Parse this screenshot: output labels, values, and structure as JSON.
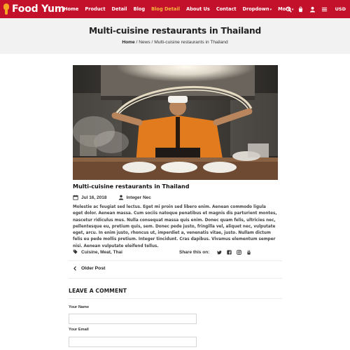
{
  "header": {
    "logo_text": "Food Yum",
    "nav": [
      {
        "label": "Home",
        "active": false,
        "caret": ""
      },
      {
        "label": "Product",
        "active": false,
        "caret": ""
      },
      {
        "label": "Detail",
        "active": false,
        "caret": ""
      },
      {
        "label": "Blog",
        "active": false,
        "caret": ""
      },
      {
        "label": "Blog Detail",
        "active": true,
        "caret": ""
      },
      {
        "label": "About Us",
        "active": false,
        "caret": ""
      },
      {
        "label": "Contact",
        "active": false,
        "caret": ""
      },
      {
        "label": "Dropdown",
        "active": false,
        "caret": "▾"
      },
      {
        "label": "More",
        "active": false,
        "caret": "▾"
      }
    ],
    "icons": [
      "search-icon",
      "cart-icon",
      "user-icon",
      "menu-icon"
    ],
    "currency": "USD",
    "colors": {
      "bar": "#c4112b",
      "active": "#f6b93b",
      "logo_accent": "#f5a623"
    }
  },
  "page": {
    "title": "Multi-cuisine restaurants in Thailand",
    "breadcrumb": {
      "home": "Home",
      "sep1": " / ",
      "news": "News",
      "sep2": " / ",
      "current": "Multi-cuisine restaurants in Thailand"
    }
  },
  "post": {
    "title": "Multi-cuisine restaurants in Thailand",
    "date": "Jul 16, 2018",
    "author": "Integer Nec",
    "body": "Molestie ac feugiat sed lectus. Eget mi proin sed libero enim. Aenean commodo ligula eget dolor. Aenean massa. Cum sociis natoque penatibus et magnis dis parturient montes, nascetur ridiculus mus. Nulla consequat massa quis enim. Donec quam felis, ultricies nec, pellentesque eu, pretium quis, sem. Donec pede justo, fringilla vel, aliquet nec, vulputate eget, arcu. In enim justo, rhoncus ut, imperdiet a, venenatis vitae, justo. Nullam dictum felis eu pede mollis pretium. Integer tincidunt. Cras dapibus. Vivamus elementum semper nisi. Aenean vulputate eleifend tellus.",
    "tags": [
      "Cuisine",
      "Meat",
      "Thai"
    ],
    "share_label": "Share this on:",
    "share_icons": [
      "twitter-icon",
      "facebook-icon",
      "instagram-icon",
      "youtube-icon"
    ]
  },
  "navigation": {
    "older": "Older Post"
  },
  "comment": {
    "heading": "LEAVE A COMMENT",
    "name_label": "Your Name",
    "email_label": "Your Email"
  }
}
